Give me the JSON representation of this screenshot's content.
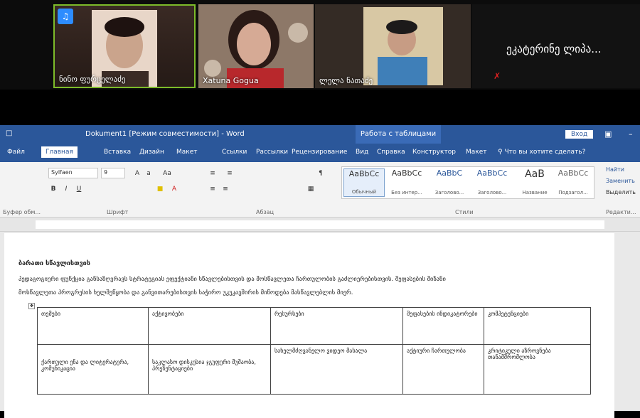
{
  "video": {
    "tiles": [
      {
        "name": "ნინო ფურცელაძე",
        "active": true
      },
      {
        "name": "Xatuna Gogua"
      },
      {
        "name": "ლელა ნათაძე"
      },
      {
        "name": "ეკატერინე ლიპა..."
      }
    ]
  },
  "word": {
    "title": "Dokument1 [Режим совместимости] - Word",
    "context_tab": "Работа с таблицами",
    "signin": "Вход",
    "tabs": [
      "Файл",
      "Главная",
      "Вставка",
      "Дизайн",
      "Макет",
      "Ссылки",
      "Рассылки",
      "Рецензирование",
      "Вид",
      "Справка",
      "Конструктор",
      "Макет",
      "Что вы хотите сделать?"
    ],
    "ribbon": {
      "font_name": "Sylfaen",
      "font_size": "9",
      "group_font": "Шрифт",
      "group_paragraph": "Абзац",
      "group_styles": "Стили",
      "group_clipboard": "Буфер обм...",
      "group_editing": "Редакти...",
      "styles": [
        {
          "sample": "AaBbCc",
          "name": "Обычный"
        },
        {
          "sample": "AaBbCc",
          "name": "Без интер..."
        },
        {
          "sample": "AaBbC",
          "name": "Заголово..."
        },
        {
          "sample": "AaBbCc",
          "name": "Заголово..."
        },
        {
          "sample": "AaB",
          "name": "Название"
        },
        {
          "sample": "AaBbCc",
          "name": "Подзагол..."
        }
      ],
      "editing": [
        "Найти",
        "Заменить",
        "Выделить"
      ]
    },
    "document": {
      "heading": "ბარათი სწავლისთვის",
      "para1": "პედაგოგიური ფუნქცია განსაზღვრავს სტრატეგიას ეფექტიანი სწავლებისთვის და მოსწავლეთა ჩართულობის გაძლიერებისთვის. შეფასების მიზანი",
      "para2": "მოსწავლეთა პროგრესის ხელშეწყობა და განვითარებისთვის საჭირო უკუკავშირის მიწოდება მასწავლებლის მიერ.",
      "table": {
        "headers": [
          "თემები",
          "აქტივობები",
          "რესურსები",
          "შეფასების ინდიკატორები",
          "კომპეტენციები"
        ],
        "row1": [
          "ქართული ენა და ლიტერატურა, კომუნიკაცია",
          "საკლასო დისკუსია ჯგუფური მუშაობა, პრეზენტაციები",
          "სახელმძღვანელო ვიდეო მასალა",
          "აქტიური ჩართულობა",
          "კრიტიკული აზროვნება თანამშრომლობა"
        ]
      }
    }
  }
}
